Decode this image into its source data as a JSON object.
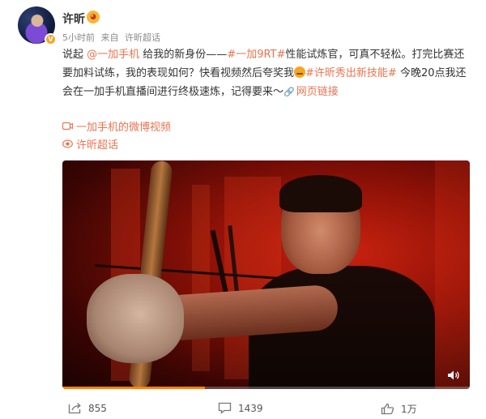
{
  "user": {
    "name": "许昕",
    "verified": true,
    "badge_color": "#f5a623"
  },
  "meta": {
    "time": "5小时前",
    "source_prefix": "来自",
    "source": "许昕超话"
  },
  "post": {
    "t1": "说起 ",
    "mention": "@一加手机",
    "t2": " 给我的新身份——",
    "hashtag1": "#一加9RT#",
    "t3": "性能试炼官，可真不轻松。打完比赛还要加料试练，我的表现如何？快看视频然后夸奖我",
    "hashtag2": "#许昕秀出新技能#",
    "t4": " 今晚20点我还会在一加手机直播间进行终极速炼，记得要来～",
    "weblink": "网页链接"
  },
  "links": {
    "video_link": "一加手机的微博视频",
    "topic_link": "许昕超话"
  },
  "video": {
    "progress": 0.35,
    "accent": "#ff8200"
  },
  "actions": {
    "forward_count": "855",
    "comment_count": "1439",
    "like_count": "1万"
  },
  "colors": {
    "link": "#eb7350",
    "text": "#333333",
    "meta": "#8a8a8a"
  },
  "icons": [
    "vip-badge-icon",
    "face-emoji-icon",
    "chain-link-icon",
    "video-icon",
    "topic-icon",
    "speaker-icon",
    "forward-icon",
    "comment-icon",
    "like-icon"
  ]
}
